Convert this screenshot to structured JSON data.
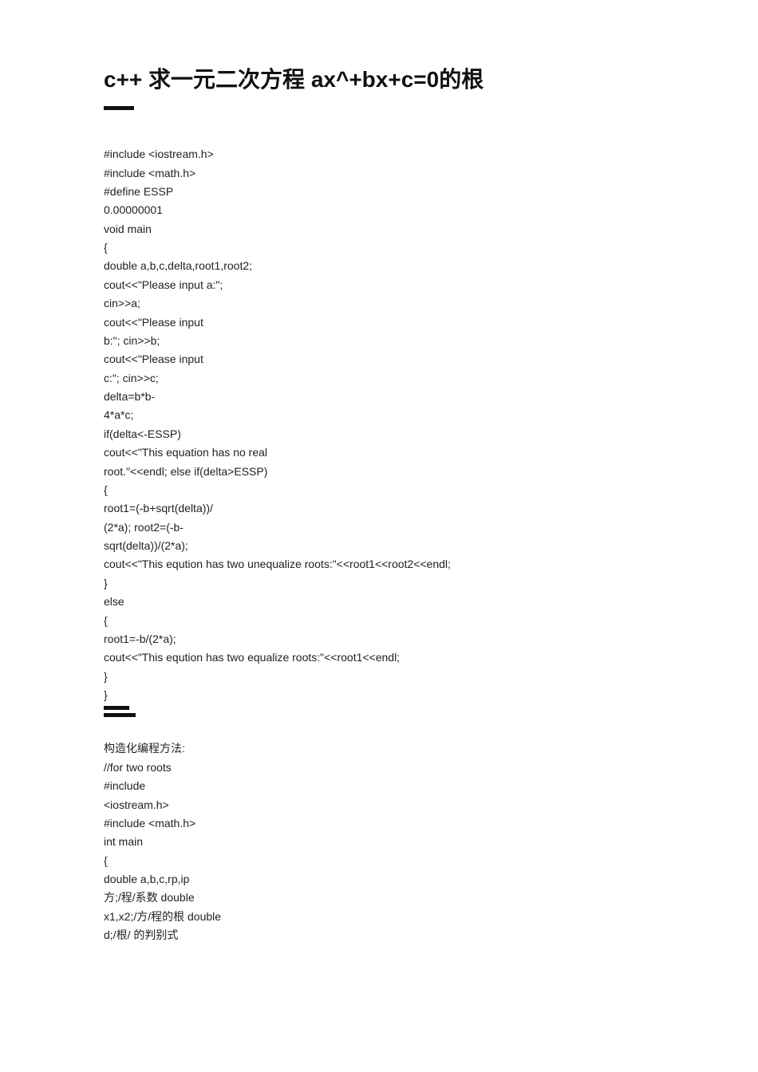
{
  "title": "c++ 求一元二次方程 ax^+bx+c=0的根",
  "code_block_1": "#include <iostream.h>\n#include <math.h>\n#define ESSP\n0.00000001\nvoid main\n{\ndouble a,b,c,delta,root1,root2;\ncout<<\"Please input a:\";\ncin>>a;\ncout<<\"Please input\nb:\"; cin>>b;\ncout<<\"Please input\nc:\"; cin>>c;\ndelta=b*b-\n4*a*c;\nif(delta<-ESSP)\ncout<<\"This equation has no real\nroot.\"<<endl; else if(delta>ESSP)\n{\nroot1=(-b+sqrt(delta))/\n(2*a); root2=(-b-\nsqrt(delta))/(2*a);\ncout<<\"This eqution has two unequalize roots:\"<<root1<<root2<<endl;\n}\nelse\n{\nroot1=-b/(2*a);\ncout<<\"This eqution has two equalize roots:\"<<root1<<endl;\n}\n}",
  "code_block_2": "构造化编程方法:\n//for two roots\n#include\n<iostream.h>\n#include <math.h>\nint main\n{\ndouble a,b,c,rp,ip\n方;/程/系数 double\nx1,x2;/方/程的根 double\nd;/根/ 的判别式"
}
